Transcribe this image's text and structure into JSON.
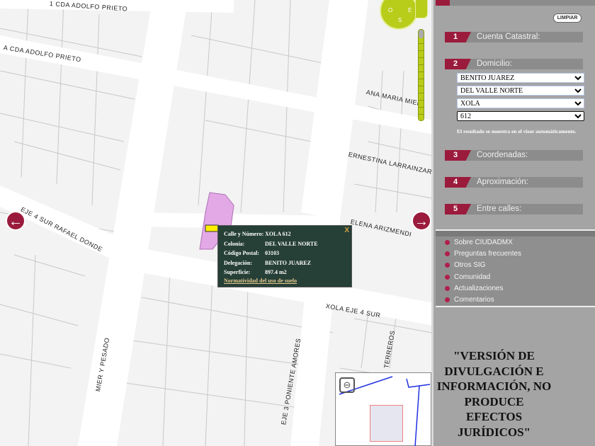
{
  "map": {
    "streets": [
      "1 CDA ADOLFO PRIETO",
      "A CDA ADOLFO PRIETO",
      "ANA MARIA MIER",
      "ERNESTINA LARRAINZAR",
      "EJE 4 SUR RAFAEL DONDE",
      "ELENA ARIZMENDI",
      "XOLA EJE 4 SUR",
      "MIER Y PESADO",
      "EJE 3 PONIENTE AMORES",
      "TERREROS"
    ],
    "compass": {
      "w": "O",
      "e": "E",
      "s": "S"
    },
    "zoom_level_fraction": 0.95,
    "popup": {
      "rows": [
        {
          "k": "Calle y Número:",
          "v": "XOLA 612"
        },
        {
          "k": "Colonia:",
          "v": "DEL VALLE NORTE"
        },
        {
          "k": "Código Postal:",
          "v": "03103"
        },
        {
          "k": "Delegación:",
          "v": "BENITO JUAREZ"
        },
        {
          "k": "Superficie:",
          "v": "897.4 m2"
        }
      ],
      "link": "Normatividad del uso de suelo",
      "close": "X"
    },
    "nav": {
      "left": "←",
      "right": "→"
    }
  },
  "panel": {
    "clear": "LIMPIAR",
    "sections": [
      {
        "num": "1",
        "title": "Cuenta Catastral:"
      },
      {
        "num": "2",
        "title": "Domicilio:"
      },
      {
        "num": "3",
        "title": "Coordenadas:"
      },
      {
        "num": "4",
        "title": "Aproximación:"
      },
      {
        "num": "5",
        "title": "Entre calles:"
      }
    ],
    "selects": [
      "BENITO JUAREZ",
      "DEL VALLE NORTE",
      "XOLA",
      "612"
    ],
    "note": "El resultado se muestra en el visor automáticamente.",
    "links": [
      "Sobre CIUDADMX",
      "Preguntas frecuentes",
      "Otros SIG",
      "Comunidad",
      "Actualizaciones",
      "Comentarios"
    ],
    "disclaimer": "\"VERSIÓN DE DIVULGACIÓN E INFORMACIÓN, NO PRODUCE EFECTOS JURÍDICOS\"",
    "accent": "#9b1b3c"
  }
}
